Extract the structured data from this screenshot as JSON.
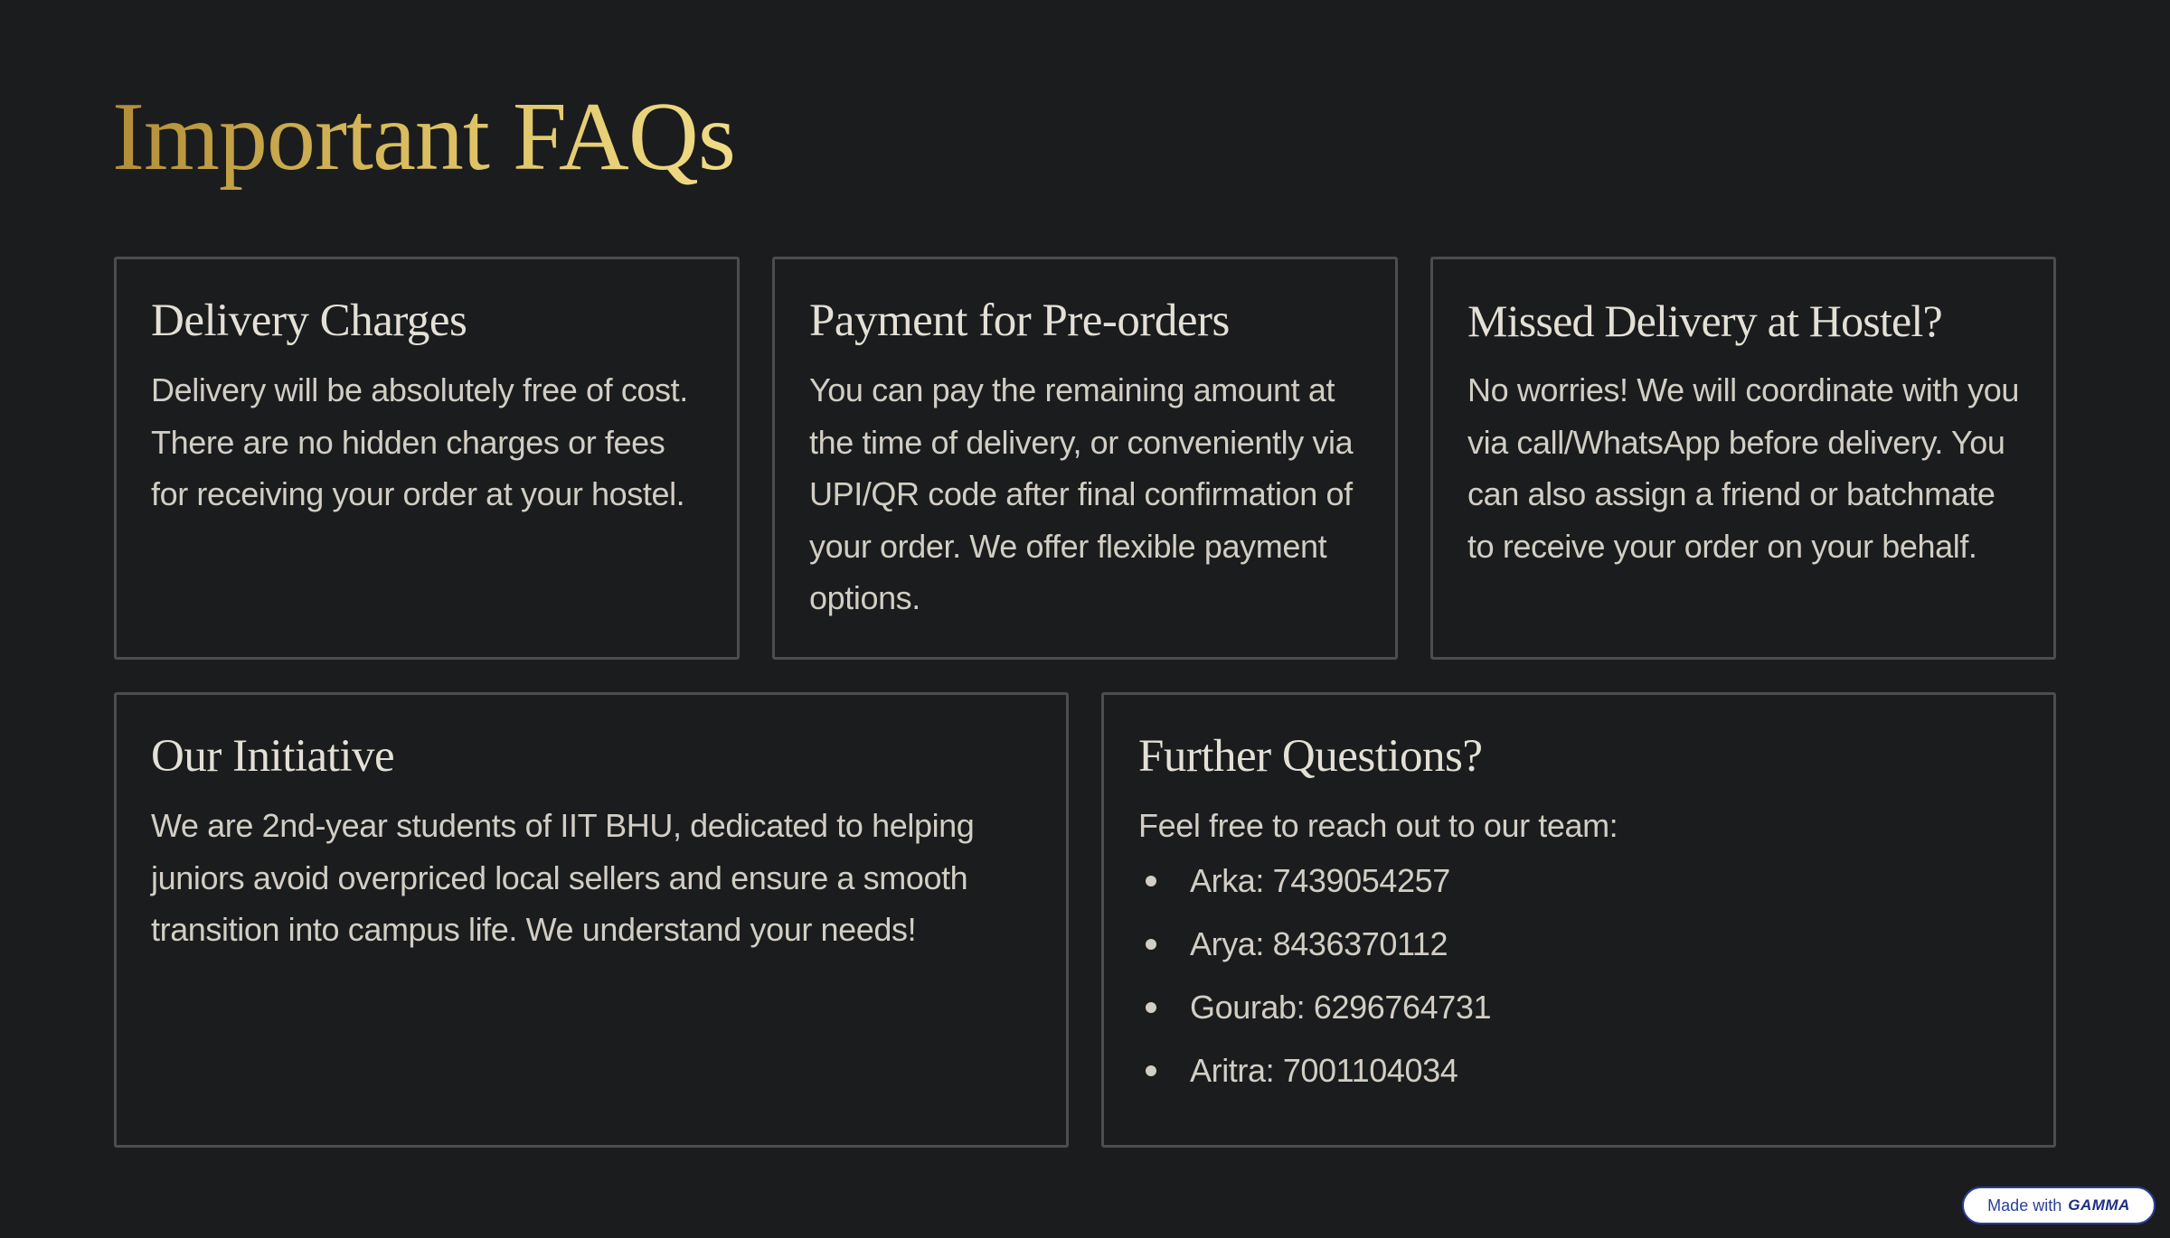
{
  "page": {
    "title": "Important FAQs"
  },
  "cards": [
    {
      "title": "Delivery Charges",
      "text": "Delivery will be absolutely free of cost. There are no hidden charges or fees for receiving your order at your hostel."
    },
    {
      "title": "Payment for Pre-orders",
      "text": "You can pay the remaining amount at the time of delivery, or conveniently via UPI/QR code after final confirmation of your order. We offer flexible payment options."
    },
    {
      "title": "Missed Delivery at Hostel?",
      "text": "No worries! We will coordinate with you via call/WhatsApp before delivery. You can also assign a friend or batchmate to receive your order on your behalf."
    },
    {
      "title": "Our Initiative",
      "text": "We are 2nd-year students of IIT BHU, dedicated to helping juniors avoid overpriced local sellers and ensure a smooth transition into campus life. We understand your needs!"
    },
    {
      "title": "Further Questions?",
      "text": "Feel free to reach out to our team:",
      "contacts": [
        "Arka: 7439054257",
        "Arya: 8436370112",
        "Gourab: 6296764731",
        "Aritra: 7001104034"
      ]
    }
  ],
  "badge": {
    "prefix": "Made with",
    "brand": "GAMMA",
    "border_color": "#2a3f9a"
  },
  "colors": {
    "background": "#1b1c1e",
    "title_gold_start": "#b28d37",
    "title_gold_end": "#f0dc86",
    "card_border": "#4c4d4f",
    "text": "#d2cec4"
  }
}
